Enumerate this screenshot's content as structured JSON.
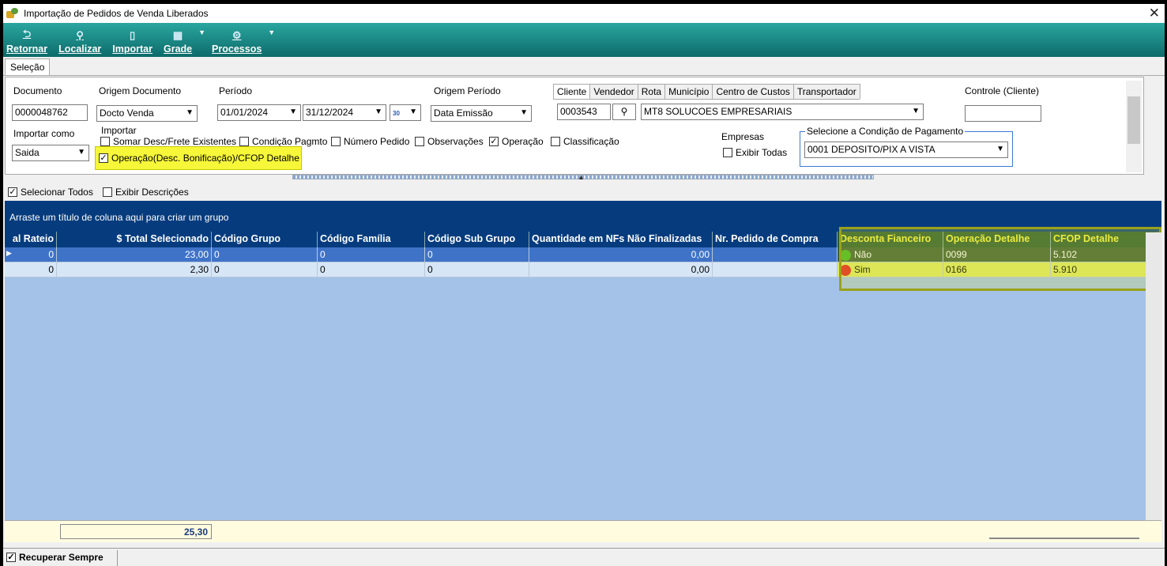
{
  "window": {
    "title": "Importação de Pedidos de Venda Liberados",
    "close_glyph": "✕"
  },
  "toolbar": {
    "items": [
      {
        "label": "Retornar",
        "icon": "undo-icon",
        "glyph": "⮌"
      },
      {
        "label": "Localizar",
        "icon": "search-icon",
        "glyph": "⚲"
      },
      {
        "label": "Importar",
        "icon": "document-icon",
        "glyph": "▯"
      },
      {
        "label": "Grade",
        "icon": "grid-icon",
        "glyph": "▦"
      },
      {
        "label": "Processos",
        "icon": "process-icon",
        "glyph": "⚙"
      }
    ],
    "dropdown_glyph": "▼"
  },
  "tabs": {
    "selecao": "Seleção"
  },
  "filters": {
    "documento_label": "Documento",
    "documento_value": "0000048762",
    "origem_documento_label": "Origem Documento",
    "origem_documento_value": "Docto Venda",
    "periodo_label": "Período",
    "periodo_inicio": "01/01/2024",
    "periodo_fim": "31/12/2024",
    "calendar_glyph": "30",
    "origem_periodo_label": "Origem Período",
    "origem_periodo_value": "Data Emissão",
    "client_tabs": [
      "Cliente",
      "Vendedor",
      "Rota",
      "Município",
      "Centro de Custos",
      "Transportador"
    ],
    "cliente_code": "0003543",
    "cliente_name": "MT8 SOLUCOES EMPRESARIAIS",
    "controle_label": "Controle (Cliente)",
    "controle_value": "",
    "importar_como_label": "Importar como",
    "importar_como_value": "Saida",
    "importar_label": "Importar",
    "importar_opts": {
      "somar_desc": "Somar Desc/Frete Existentes",
      "condicao": "Condição Pagmto",
      "numero_pedido": "Número Pedido",
      "observacoes": "Observações",
      "operacao": "Operação",
      "classificacao": "Classificação",
      "operacao_detalhe": "Operação(Desc. Bonificação)/CFOP Detalhe"
    },
    "empresas_label": "Empresas",
    "exibir_todas": "Exibir Todas",
    "condicao_pagamento_label": "Selecione a Condição de Pagamento",
    "condicao_pagamento_value": "0001 DEPOSITO/PIX A VISTA",
    "check_glyph": "✓",
    "arrow_glyph": "▼"
  },
  "options": {
    "selecionar_todos": "Selecionar Todos",
    "exibir_descricoes": "Exibir Descrições"
  },
  "grid": {
    "group_hint": "Arraste um título de coluna aqui para criar um grupo",
    "columns": [
      "al Rateio",
      "$ Total Selecionado",
      "Código Grupo",
      "Código Família",
      "Código Sub Grupo",
      "Quantidade em NFs Não Finalizadas",
      "Nr. Pedido de Compra",
      "Desconta Fianceiro",
      "Operação Detalhe",
      "CFOP Detalhe"
    ],
    "rows": [
      {
        "rateio": "0",
        "total": "23,00",
        "grupo": "0",
        "familia": "0",
        "subgrupo": "0",
        "qtd": "0,00",
        "pedido": "",
        "desconta": "Não",
        "desconta_color": "#3fb51f",
        "operacao": "0099",
        "cfop": "5.102"
      },
      {
        "rateio": "0",
        "total": "2,30",
        "grupo": "0",
        "familia": "0",
        "subgrupo": "0",
        "qtd": "0,00",
        "pedido": "",
        "desconta": "Sim",
        "desconta_color": "#e02020",
        "operacao": "0166",
        "cfop": "5.910"
      }
    ],
    "row_indicator_glyph": "▶",
    "total_sum": "25,30"
  },
  "statusbar": {
    "recuperar_sempre": "Recuperar Sempre"
  },
  "colors": {
    "accent_teal": "#0d6b6a",
    "grid_header": "#063c7e",
    "highlight": "#f7f73a"
  }
}
